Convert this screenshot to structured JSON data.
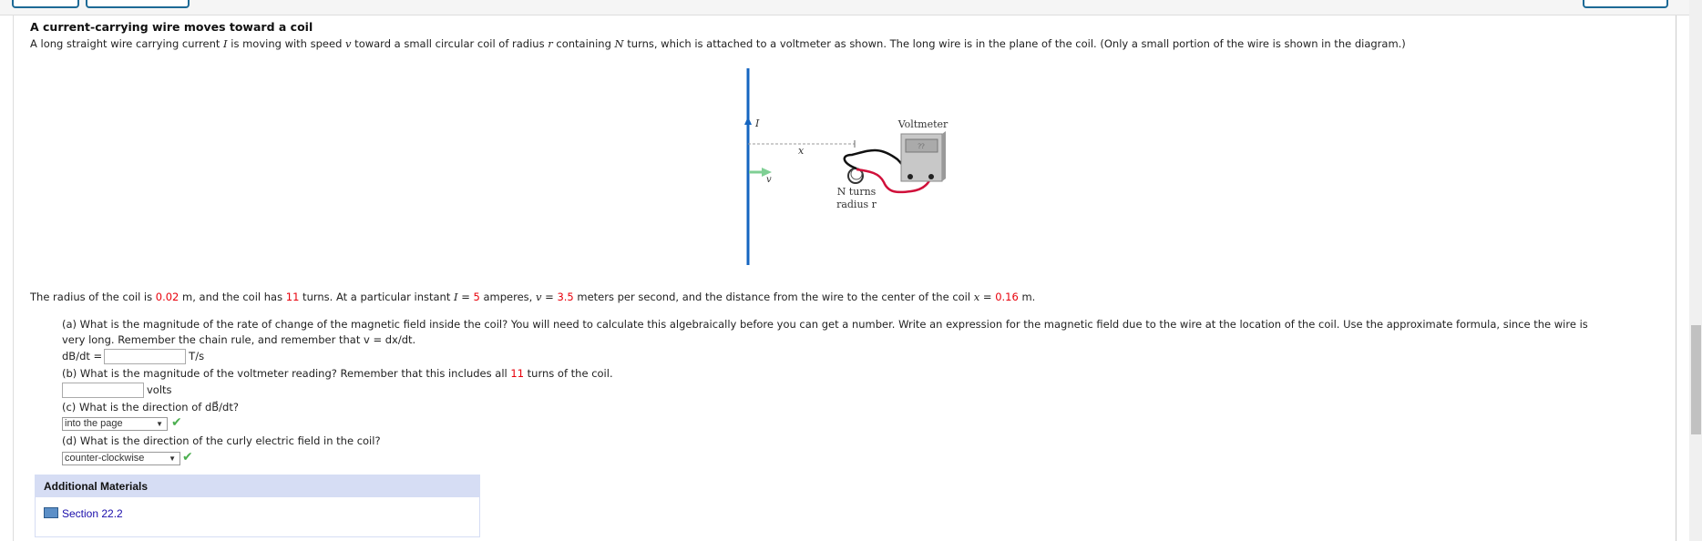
{
  "problem": {
    "title": "A current-carrying wire moves toward a coil",
    "description": [
      "A long straight wire carrying current ",
      "I",
      " is moving with speed ",
      "v",
      " toward a small circular coil of radius ",
      "r",
      " containing ",
      "N",
      " turns, which is attached to a voltmeter as shown. The long wire is in the plane of the coil. (Only a small portion of the wire is shown in the diagram.)"
    ]
  },
  "diagram": {
    "label_current": "I",
    "label_x": "x",
    "label_v": "v",
    "label_voltmeter": "Voltmeter",
    "meter_display": "??",
    "label_n_turns": "N turns",
    "label_radius": "radius r",
    "wire_color": "#1565c0",
    "velocity_color": "#7fcf94"
  },
  "given": {
    "t1": "The radius of the coil is ",
    "radius": "0.02",
    "t2": " m, and the coil has ",
    "turns": "11",
    "t3": " turns. At a particular instant ",
    "I_sym": "I",
    "t4": " = ",
    "current": "5",
    "t5": " amperes, ",
    "v_sym": "v",
    "t6": " = ",
    "speed": "3.5",
    "t7": " meters per second, and the distance from the wire to the center of the coil ",
    "x_sym": "x",
    "t8": " = ",
    "distance": "0.16",
    "t9": " m."
  },
  "parts": {
    "a_line1": "(a) What is the magnitude of the rate of change of the magnetic field inside the coil? You will need to calculate this algebraically before you can get a number. Write an expression for the magnetic field due to the wire at the location of the coil. Use the approximate formula, since the wire is",
    "a_line2": "very long. Remember the chain rule, and remember that v = dx/dt.",
    "a_label": "dB/dt =",
    "a_value": "",
    "a_unit": "T/s",
    "b_q1": "(b) What is the magnitude of the voltmeter reading? Remember that this includes all ",
    "b_turns": "11",
    "b_q2": " turns of the coil.",
    "b_value": "",
    "b_unit": "volts",
    "c_q": "(c) What is the direction of dB⃗/dt?",
    "c_selected": "into the page",
    "d_q": "(d) What is the direction of the curly electric field in the coil?",
    "d_selected": "counter-clockwise"
  },
  "additional": {
    "header": "Additional Materials",
    "link": "Section 22.2"
  },
  "colors": {
    "given_value": "#e8000b",
    "correct": "#4caf50",
    "link": "#1a0dab"
  }
}
